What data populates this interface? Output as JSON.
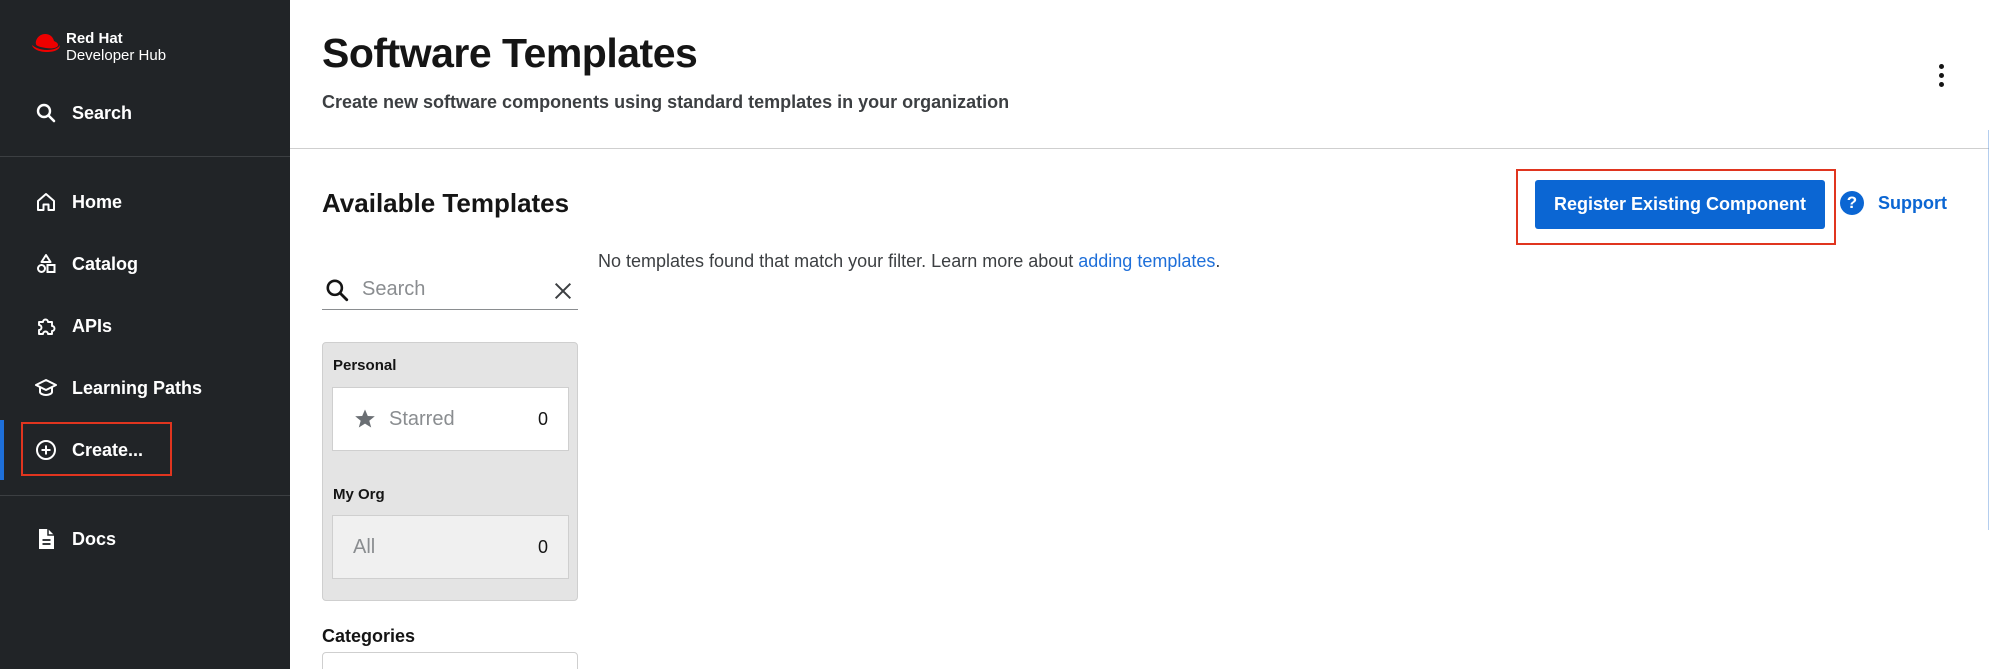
{
  "sidebar": {
    "logo": {
      "brand": "Red Hat",
      "product": "Developer Hub"
    },
    "search_label": "Search",
    "items": [
      {
        "label": "Home",
        "icon": "home-icon"
      },
      {
        "label": "Catalog",
        "icon": "catalog-icon"
      },
      {
        "label": "APIs",
        "icon": "puzzle-icon"
      },
      {
        "label": "Learning Paths",
        "icon": "graduation-cap-icon"
      },
      {
        "label": "Create...",
        "icon": "plus-circle-icon",
        "active": true
      }
    ],
    "docs_label": "Docs"
  },
  "header": {
    "title": "Software Templates",
    "subtitle": "Create new software components using standard templates in your organization"
  },
  "main": {
    "section_title": "Available Templates",
    "register_button": "Register Existing Component",
    "support_link": "Support",
    "search": {
      "placeholder": "Search",
      "value": ""
    },
    "filters": {
      "personal_title": "Personal",
      "starred": {
        "label": "Starred",
        "count": "0"
      },
      "org_title": "My Org",
      "all": {
        "label": "All",
        "count": "0"
      }
    },
    "categories_label": "Categories",
    "empty_message": {
      "text": "No templates found that match your filter. Learn more about ",
      "link": "adding templates",
      "suffix": "."
    }
  },
  "colors": {
    "sidebar_bg": "#212427",
    "accent": "#0b66d3",
    "highlight": "#e0351f"
  }
}
